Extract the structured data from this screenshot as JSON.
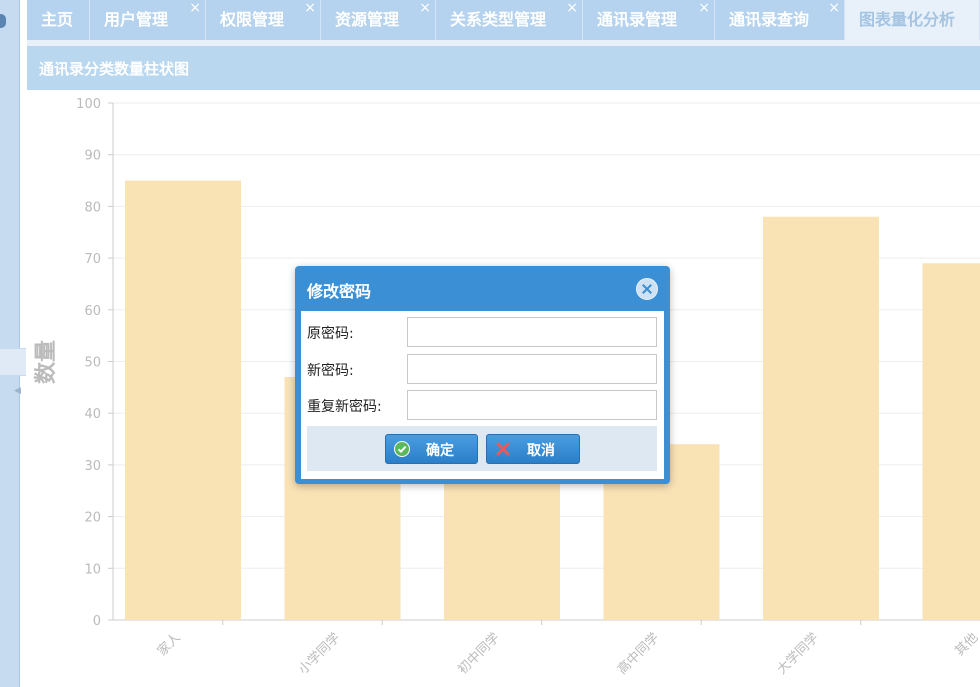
{
  "tabs": [
    {
      "label": "主页",
      "closable": false
    },
    {
      "label": "用户管理",
      "closable": true
    },
    {
      "label": "权限管理",
      "closable": true
    },
    {
      "label": "资源管理",
      "closable": true
    },
    {
      "label": "关系类型管理",
      "closable": true
    },
    {
      "label": "通讯录管理",
      "closable": true
    },
    {
      "label": "通讯录查询",
      "closable": true
    },
    {
      "label": "图表量化分析",
      "closable": false,
      "active": true
    }
  ],
  "close_glyph": "×",
  "panel": {
    "title": "通讯录分类数量柱状图"
  },
  "chart_data": {
    "type": "bar",
    "categories": [
      "家人",
      "小学同学",
      "初中同学",
      "高中同学",
      "大学同学",
      "其他"
    ],
    "values": [
      85,
      47,
      40,
      34,
      78,
      69
    ],
    "ylabel": "数量",
    "xlabel": "",
    "ylim": [
      0,
      100
    ],
    "yticks": [
      0,
      10,
      20,
      30,
      40,
      50,
      60,
      70,
      80,
      90,
      100
    ],
    "grid": true,
    "bar_color": "#f9e2b4"
  },
  "dialog": {
    "title": "修改密码",
    "fields": [
      {
        "label": "原密码:",
        "value": ""
      },
      {
        "label": "新密码:",
        "value": ""
      },
      {
        "label": "重复新密码:",
        "value": ""
      }
    ],
    "confirm_label": "确定",
    "cancel_label": "取消"
  },
  "colors": {
    "tab_bg": "#b5d3ee",
    "header_bg": "#b9d7ef",
    "dialog_bg": "#3b8fd5",
    "confirm_icon": "#5cb85c",
    "cancel_icon": "#e55b5b"
  },
  "icons": {
    "confirm": "check-circle-icon",
    "cancel": "x-icon",
    "dialog_close": "close-circle-icon"
  }
}
